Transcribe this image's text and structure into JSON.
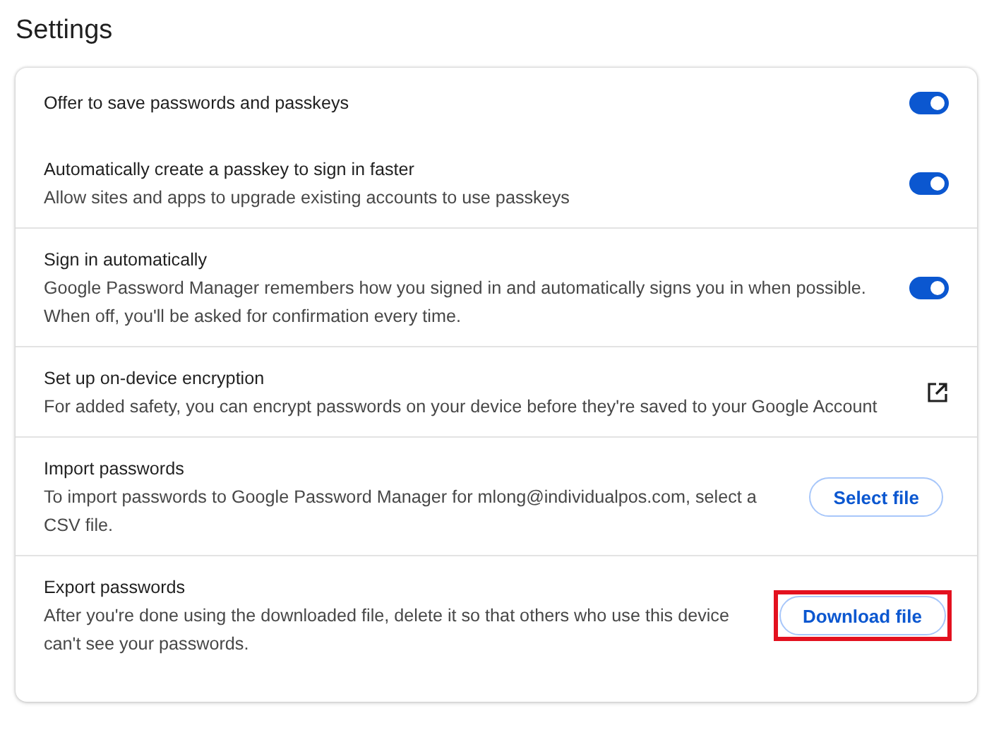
{
  "page_title": "Settings",
  "items": [
    {
      "kind": "toggle",
      "title": "Offer to save passwords and passkeys",
      "on": true,
      "divider": false
    },
    {
      "kind": "toggle",
      "title": "Automatically create a passkey to sign in faster",
      "description": "Allow sites and apps to upgrade existing accounts to use passkeys",
      "on": true,
      "divider": false
    },
    {
      "kind": "toggle",
      "title": "Sign in automatically",
      "description": "Google Password Manager remembers how you signed in and automatically signs you in when possible. When off, you'll be asked for confirmation every time.",
      "on": true,
      "divider": true
    },
    {
      "kind": "link",
      "title": "Set up on-device encryption",
      "description": "For added safety, you can encrypt passwords on your device before they're saved to your Google Account",
      "divider": true
    },
    {
      "kind": "button",
      "title": "Import passwords",
      "description": "To import passwords to Google Password Manager for mlong@individualpos.com, select a CSV file.",
      "button": "Select file",
      "highlighted": false,
      "divider": true
    },
    {
      "kind": "button",
      "title": "Export passwords",
      "description": "After you're done using the downloaded file, delete it so that others who use this device can't see your passwords.",
      "button": "Download file",
      "highlighted": true,
      "divider": true
    }
  ]
}
